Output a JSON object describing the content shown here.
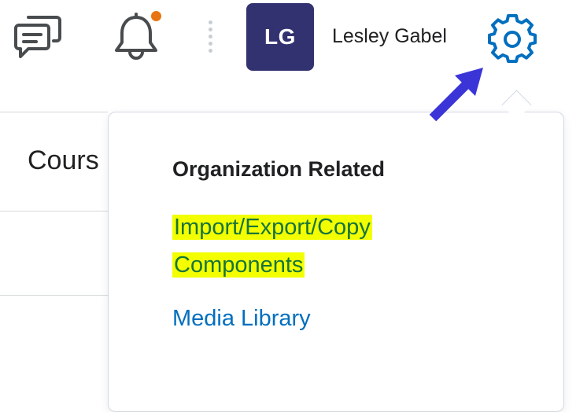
{
  "topbar": {
    "messages_icon": "chat-bubbles-icon",
    "notifications_icon": "bell-icon",
    "notification_dot_color": "#e87511",
    "avatar_initials": "LG",
    "avatar_color": "#333271",
    "user_name": "Lesley Gabel",
    "settings_icon": "gear-icon",
    "accent_color": "#006fbf"
  },
  "background": {
    "partial_heading": "Cours"
  },
  "dropdown": {
    "title": "Organization Related",
    "items": [
      {
        "label_line1": "Import/Export/Copy",
        "label_line2": "Components",
        "highlighted": true
      },
      {
        "label": "Media Library",
        "highlighted": false
      }
    ]
  },
  "annotation": {
    "arrow_color": "#3b35d8",
    "highlight_color": "#f3ff00"
  }
}
